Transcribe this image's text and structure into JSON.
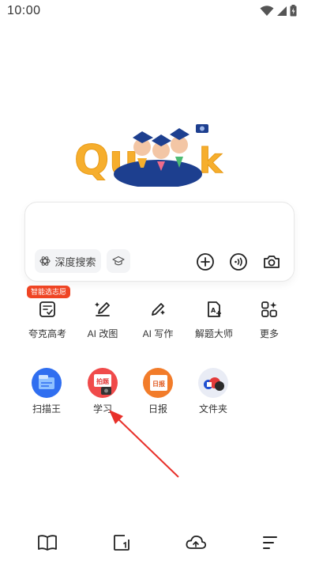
{
  "status_bar": {
    "time": "10:00"
  },
  "logo": {
    "text": "Quark"
  },
  "search": {
    "deep_search_label": "深度搜索",
    "icons": [
      "atom-icon",
      "graduation-cap-icon",
      "plus-icon",
      "voice-icon",
      "camera-icon"
    ]
  },
  "badge": {
    "text": "智能选志愿"
  },
  "tools": [
    {
      "label": "夸克高考",
      "icon": "exam-icon"
    },
    {
      "label": "AI 改图",
      "icon": "ai-edit-image-icon"
    },
    {
      "label": "AI 写作",
      "icon": "ai-write-icon"
    },
    {
      "label": "解题大师",
      "icon": "solve-icon"
    },
    {
      "label": "更多",
      "icon": "more-grid-icon"
    }
  ],
  "apps": [
    {
      "label": "扫描王",
      "icon": "scanner-icon",
      "color": "#2f6ef0"
    },
    {
      "label": "学习",
      "icon": "study-icon",
      "color": "#f04a4a",
      "inner_text": "拍题"
    },
    {
      "label": "日报",
      "icon": "daily-icon",
      "color": "#f27c2a",
      "inner_text": "日报"
    },
    {
      "label": "文件夹",
      "icon": "folder-icon",
      "color": "#e9ecf5"
    }
  ],
  "bottom_nav": [
    "book-icon",
    "tabs-icon",
    "cloud-icon",
    "menu-icon"
  ],
  "colors": {
    "accent": "#ef4423",
    "arrow": "#e8302a"
  }
}
